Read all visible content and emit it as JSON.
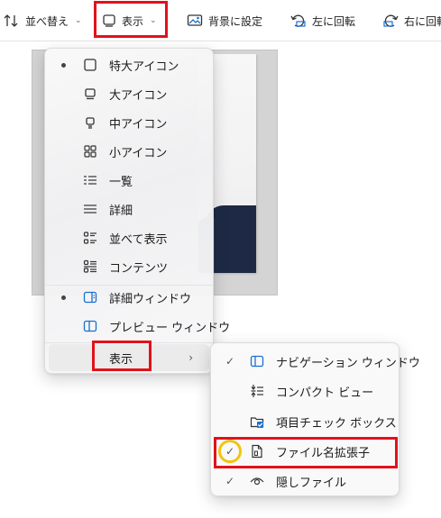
{
  "toolbar": {
    "sort_label": "並べ替え",
    "view_label": "表示",
    "set_background_label": "背景に設定",
    "rotate_left_label": "左に回転",
    "rotate_right_label": "右に回転"
  },
  "view_menu": {
    "items": [
      {
        "label": "特大アイコン",
        "icon": "extra-large-icons-icon",
        "selected": true
      },
      {
        "label": "大アイコン",
        "icon": "large-icons-icon",
        "selected": false
      },
      {
        "label": "中アイコン",
        "icon": "medium-icons-icon",
        "selected": false
      },
      {
        "label": "小アイコン",
        "icon": "small-icons-icon",
        "selected": false
      },
      {
        "label": "一覧",
        "icon": "list-icon",
        "selected": false
      },
      {
        "label": "詳細",
        "icon": "details-icon",
        "selected": false
      },
      {
        "label": "並べて表示",
        "icon": "tiles-icon",
        "selected": false
      },
      {
        "label": "コンテンツ",
        "icon": "content-icon",
        "selected": false
      }
    ],
    "pane_items": [
      {
        "label": "詳細ウィンドウ",
        "icon": "details-pane-icon",
        "selected": true
      },
      {
        "label": "プレビュー ウィンドウ",
        "icon": "preview-pane-icon",
        "selected": false
      }
    ],
    "show_item": {
      "label": "表示",
      "arrow": "›"
    }
  },
  "show_submenu": {
    "items": [
      {
        "label": "ナビゲーション ウィンドウ",
        "icon": "navigation-pane-icon",
        "checked": true
      },
      {
        "label": "コンパクト ビュー",
        "icon": "compact-view-icon",
        "checked": false
      },
      {
        "label": "項目チェック ボックス",
        "icon": "item-checkbox-icon",
        "checked": false
      },
      {
        "label": "ファイル名拡張子",
        "icon": "file-extension-icon",
        "checked": true
      },
      {
        "label": "隠しファイル",
        "icon": "hidden-files-icon",
        "checked": true
      }
    ],
    "check_glyph": "✓"
  },
  "colors": {
    "highlight_red": "#e0121b",
    "highlight_yellow": "#f1c40f",
    "accent_blue": "#1a6fd1"
  }
}
